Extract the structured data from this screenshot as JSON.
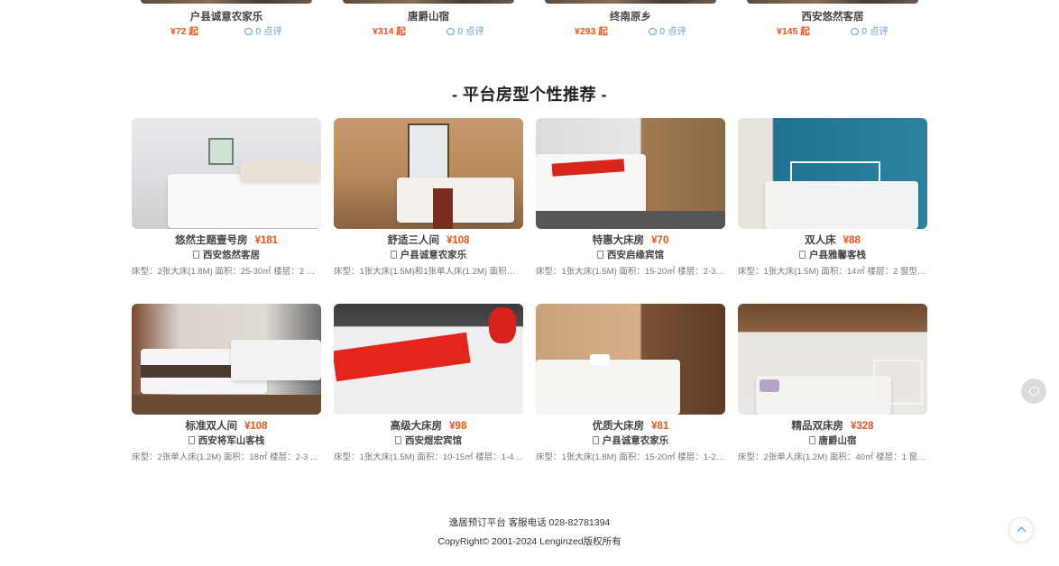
{
  "top_hotels": [
    {
      "name": "户县诚意农家乐",
      "price": "¥72 起",
      "comments": "0 点评"
    },
    {
      "name": "唐爵山宿",
      "price": "¥314 起",
      "comments": "0 点评"
    },
    {
      "name": "终南原乡",
      "price": "¥293 起",
      "comments": "0 点评"
    },
    {
      "name": "西安悠然客居",
      "price": "¥145 起",
      "comments": "0 点评"
    }
  ],
  "section": {
    "title": "- 平台房型个性推荐 -"
  },
  "rooms": [
    {
      "name": "悠然主题壹号房",
      "price": "¥181",
      "hotel": "西安悠然客居",
      "desc": "床型：2张大床(1.8M) 面积：25-30㎡ 楼层：2 窗..."
    },
    {
      "name": "舒适三人间",
      "price": "¥108",
      "hotel": "户县诚意农家乐",
      "desc": "床型：1张大床(1.5M)和1张单人床(1.2M) 面积：1..."
    },
    {
      "name": "特惠大床房",
      "price": "¥70",
      "hotel": "西安启缘宾馆",
      "desc": "床型：1张大床(1.5M) 面积：15-20㎡ 楼层：2-3 ..."
    },
    {
      "name": "双人床",
      "price": "¥88",
      "hotel": "户县雅馨客栈",
      "desc": "床型：1张大床(1.5M) 面积：14㎡ 楼层：2 窗型：..."
    },
    {
      "name": "标准双人间",
      "price": "¥108",
      "hotel": "西安将军山客栈",
      "desc": "床型：2张单人床(1.2M) 面积：18㎡ 楼层：2-3 窗..."
    },
    {
      "name": "高级大床房",
      "price": "¥98",
      "hotel": "西安煜宏宾馆",
      "desc": "床型：1张大床(1.5M) 面积：10-15㎡ 楼层：1-4 ..."
    },
    {
      "name": "优质大床房",
      "price": "¥81",
      "hotel": "户县诚意农家乐",
      "desc": "床型：1张大床(1.8M) 面积：15-20㎡ 楼层：1-2 ..."
    },
    {
      "name": "精品双床房",
      "price": "¥328",
      "hotel": "唐爵山宿",
      "desc": "床型：2张单人床(1.2M) 面积：40㎡ 楼层：1 窗型..."
    }
  ],
  "footer": {
    "contact": "逸居预订平台 客服电话 028-82781394",
    "copyright": "CopyRight© 2001-2024 Lenginzed版权所有"
  },
  "colors": {
    "price": "#f2541d",
    "comment": "#6a9bd8"
  },
  "icons": [
    "comment-icon",
    "hotel-icon",
    "chat-icon",
    "back-to-top-icon"
  ]
}
